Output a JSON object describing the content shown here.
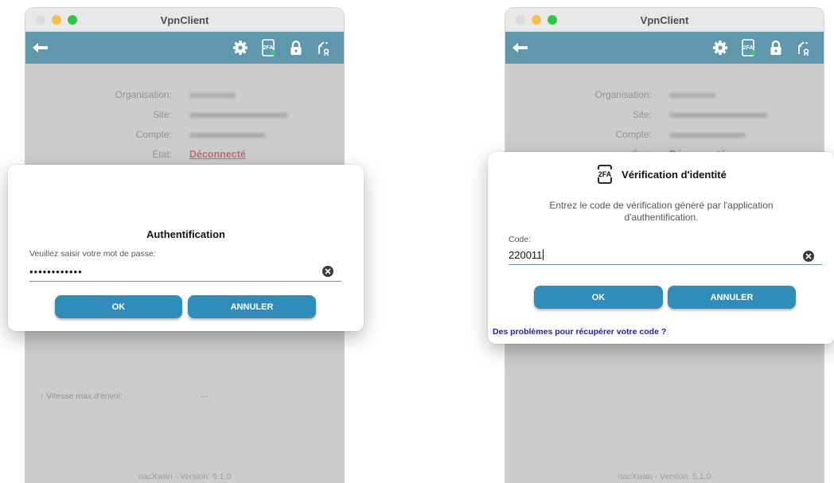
{
  "app_title": "VpnClient",
  "toolbar": {
    "icons": [
      "back-arrow-icon",
      "gear-icon",
      "2fa-icon",
      "lock-icon",
      "split-tunnel-icon"
    ]
  },
  "info": {
    "organisation_label": "Organisation:",
    "site_label": "Site:",
    "compte_label": "Compte:",
    "etat_label": "État:",
    "etat_value": "Déconnecté",
    "speed_label": "↑ Vitesse max.d'envoi:",
    "speed_value": "..."
  },
  "version": "nacXwan - Version: 5.1.0",
  "auth_dialog": {
    "title": "Authentification",
    "prompt": "Veuillez saisir votre mot de passe:",
    "password_mask": "••••••••••••",
    "ok_label": "OK",
    "cancel_label": "ANNULER"
  },
  "twofa_dialog": {
    "badge": "2FA",
    "title": "Vérification d'identité",
    "description": "Entrez le code de vérification généré par l'application d'authentification.",
    "code_label": "Code:",
    "code_value": "220011",
    "ok_label": "OK",
    "cancel_label": "ANNULER",
    "help_link": "Des problèmes pour récupérer votre code ?"
  },
  "colors": {
    "toolbar": "#5f97ad",
    "button": "#2f8dbb",
    "state": "#e0686a",
    "link": "#1a1ad8"
  }
}
